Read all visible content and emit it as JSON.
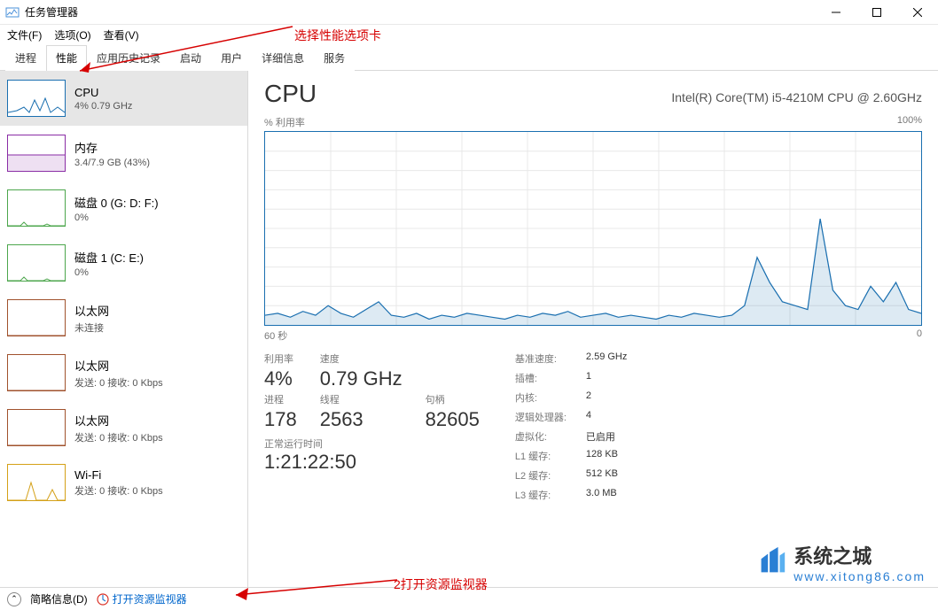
{
  "window": {
    "title": "任务管理器"
  },
  "menu": {
    "file": "文件(F)",
    "options": "选项(O)",
    "view": "查看(V)"
  },
  "tabs": [
    "进程",
    "性能",
    "应用历史记录",
    "启动",
    "用户",
    "详细信息",
    "服务"
  ],
  "activeTab": 1,
  "sidebar": {
    "items": [
      {
        "name": "CPU",
        "sub": "4% 0.79 GHz",
        "type": "cpu"
      },
      {
        "name": "内存",
        "sub": "3.4/7.9 GB (43%)",
        "type": "mem"
      },
      {
        "name": "磁盘 0 (G: D: F:)",
        "sub": "0%",
        "type": "disk"
      },
      {
        "name": "磁盘 1 (C: E:)",
        "sub": "0%",
        "type": "disk"
      },
      {
        "name": "以太网",
        "sub": "未连接",
        "type": "eth"
      },
      {
        "name": "以太网",
        "sub": "发送: 0 接收: 0 Kbps",
        "type": "eth"
      },
      {
        "name": "以太网",
        "sub": "发送: 0 接收: 0 Kbps",
        "type": "eth"
      },
      {
        "name": "Wi-Fi",
        "sub": "发送: 0 接收: 0 Kbps",
        "type": "wifi"
      }
    ]
  },
  "detail": {
    "title": "CPU",
    "model": "Intel(R) Core(TM) i5-4210M CPU @ 2.60GHz",
    "chart_top_left": "% 利用率",
    "chart_top_right": "100%",
    "chart_bottom_left": "60 秒",
    "chart_bottom_right": "0",
    "left_labels": {
      "util": "利用率",
      "speed": "速度",
      "proc": "进程",
      "threads": "线程",
      "handles": "句柄",
      "uptime": "正常运行时间"
    },
    "left_values": {
      "util": "4%",
      "speed": "0.79 GHz",
      "proc": "178",
      "threads": "2563",
      "handles": "82605",
      "uptime": "1:21:22:50"
    },
    "right": [
      {
        "lbl": "基准速度:",
        "val": "2.59 GHz"
      },
      {
        "lbl": "插槽:",
        "val": "1"
      },
      {
        "lbl": "内核:",
        "val": "2"
      },
      {
        "lbl": "逻辑处理器:",
        "val": "4"
      },
      {
        "lbl": "虚拟化:",
        "val": "已启用"
      },
      {
        "lbl": "L1 缓存:",
        "val": "128 KB"
      },
      {
        "lbl": "L2 缓存:",
        "val": "512 KB"
      },
      {
        "lbl": "L3 缓存:",
        "val": "3.0 MB"
      }
    ]
  },
  "footer": {
    "brief": "简略信息(D)",
    "resmon": "打开资源监视器"
  },
  "annotations": {
    "tab": "选择性能选项卡",
    "resmon": "2打开资源监视器"
  },
  "watermark": {
    "text1": "系统之城",
    "text2": "www.xitong86.com"
  },
  "chart_data": {
    "type": "line",
    "title": "% 利用率",
    "ylim": [
      0,
      100
    ],
    "xlabel_left": "60 秒",
    "xlabel_right": "0",
    "points": [
      5,
      6,
      4,
      7,
      5,
      10,
      6,
      4,
      8,
      12,
      5,
      4,
      6,
      3,
      5,
      4,
      6,
      5,
      4,
      3,
      5,
      4,
      6,
      5,
      7,
      4,
      5,
      6,
      4,
      5,
      4,
      3,
      5,
      4,
      6,
      5,
      4,
      5,
      10,
      35,
      22,
      12,
      10,
      8,
      55,
      18,
      10,
      8,
      20,
      12,
      22,
      8,
      6
    ]
  }
}
